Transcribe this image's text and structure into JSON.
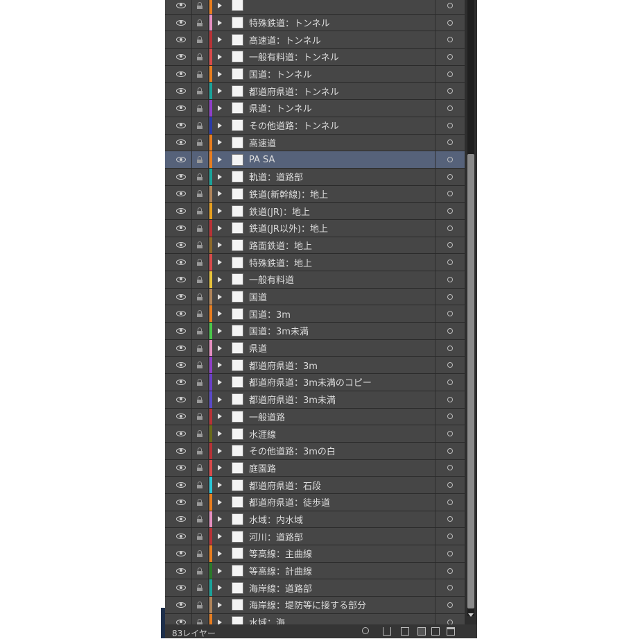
{
  "layers": [
    {
      "name": "",
      "color": "#e87d1e"
    },
    {
      "name": "特殊鉄道：トンネル",
      "color": "#e58fc0"
    },
    {
      "name": "高速道：トンネル",
      "color": "#b83236"
    },
    {
      "name": "一般有料道：トンネル",
      "color": "#d84a4a"
    },
    {
      "name": "国道：トンネル",
      "color": "#e87d1e"
    },
    {
      "name": "都道府県道：トンネル",
      "color": "#1aa39a"
    },
    {
      "name": "県道：トンネル",
      "color": "#8f3fc8"
    },
    {
      "name": "その他道路：トンネル",
      "color": "#2a3aa8"
    },
    {
      "name": "高速道",
      "color": "#e87d1e"
    },
    {
      "name": "PA SA",
      "color": "#e87d1e",
      "selected": true
    },
    {
      "name": "軌道：道路部",
      "color": "#1aa39a"
    },
    {
      "name": "鉄道(新幹線)：地上",
      "color": "#b0845a"
    },
    {
      "name": "鉄道(JR)：地上",
      "color": "#e8a01e"
    },
    {
      "name": "鉄道(JR以外)：地上",
      "color": "#b83236"
    },
    {
      "name": "路面鉄道：地上",
      "color": "#8f6a2a"
    },
    {
      "name": "特殊鉄道：地上",
      "color": "#d84a4a"
    },
    {
      "name": "一般有料道",
      "color": "#e8c23a"
    },
    {
      "name": "国道",
      "color": "#b0845a"
    },
    {
      "name": "国道：3m",
      "color": "#e87d1e"
    },
    {
      "name": "国道：3m未満",
      "color": "#4ac84a"
    },
    {
      "name": "県道",
      "color": "#e58fc0"
    },
    {
      "name": "都道府県道：3m",
      "color": "#8f3fc8"
    },
    {
      "name": "都道府県道：3m未満のコピー",
      "color": "#6a3fc8"
    },
    {
      "name": "都道府県道：3m未満",
      "color": "#5a4ac8"
    },
    {
      "name": "一般道路",
      "color": "#b83236"
    },
    {
      "name": "水涯線",
      "color": "#6a6a1a"
    },
    {
      "name": "その他道路：3mの白",
      "color": "#b83236"
    },
    {
      "name": "庭園路",
      "color": "#d84a4a"
    },
    {
      "name": "都道府県道：石段",
      "color": "#2ac8d8"
    },
    {
      "name": "都道府県道：徒歩道",
      "color": "#e87d1e"
    },
    {
      "name": "水域：内水域",
      "color": "#e58fc0"
    },
    {
      "name": "河川：道路部",
      "color": "#b83236"
    },
    {
      "name": "等高線：主曲線",
      "color": "#e87d1e"
    },
    {
      "name": "等高線：計曲線",
      "color": "#2a7a2a"
    },
    {
      "name": "海岸線：道路部",
      "color": "#1aa39a"
    },
    {
      "name": "海岸線：堤防等に接する部分",
      "color": "#b0845a"
    },
    {
      "name": "水域：海",
      "color": "#e87d1e"
    }
  ],
  "footer": {
    "layer_count": "83レイヤー"
  }
}
